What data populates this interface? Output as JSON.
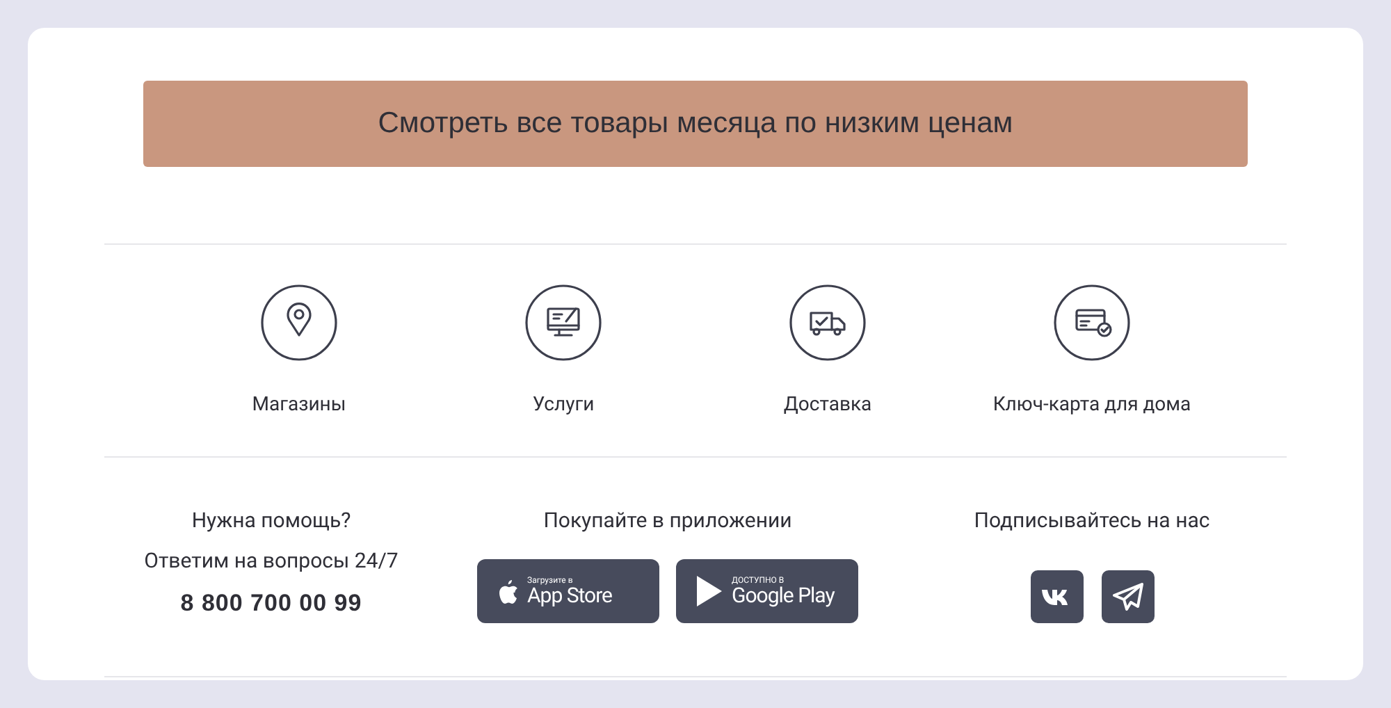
{
  "promo_button": {
    "label": "Смотреть все товары месяца по низким ценам"
  },
  "features": [
    {
      "kind": "pin",
      "label": "Магазины"
    },
    {
      "kind": "monitor",
      "label": "Услуги"
    },
    {
      "kind": "truck",
      "label": "Доставка"
    },
    {
      "kind": "card",
      "label": "Ключ-карта для дома"
    }
  ],
  "help": {
    "title": "Нужна помощь?",
    "subtitle": "Ответим на вопросы 24/7",
    "phone": "8 800 700 00 99"
  },
  "apps": {
    "title": "Покупайте в приложении",
    "badges": [
      {
        "kind": "apple",
        "small": "Загрузите в",
        "big": "App Store"
      },
      {
        "kind": "google",
        "small": "ДОСТУПНО В",
        "big": "Google Play"
      }
    ]
  },
  "social": {
    "title": "Подписывайтесь на нас",
    "links": [
      {
        "kind": "vk"
      },
      {
        "kind": "telegram"
      }
    ]
  }
}
